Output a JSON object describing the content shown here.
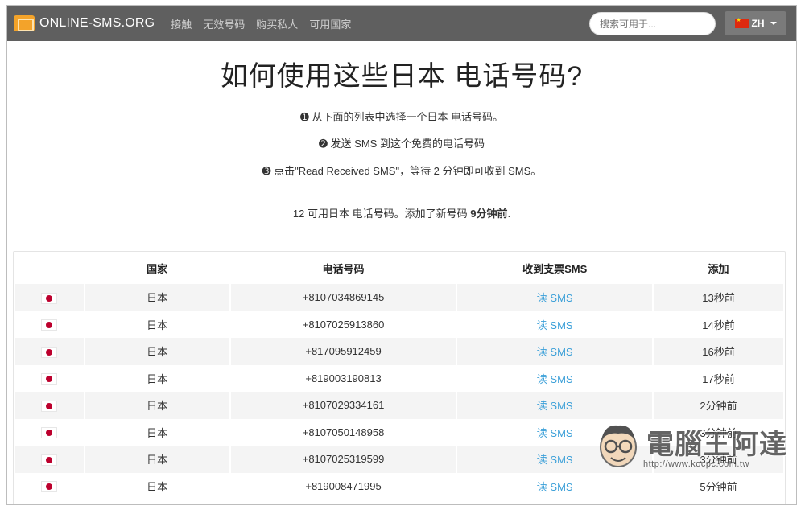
{
  "navbar": {
    "brand": "ONLINE-SMS.ORG",
    "links": [
      "接触",
      "无效号码",
      "购买私人",
      "可用国家"
    ],
    "search_placeholder": "搜索可用于...",
    "lang": "ZH"
  },
  "header": {
    "title": "如何使用这些日本 电话号码?",
    "steps": [
      "➊ 从下面的列表中选择一个日本 电话号码。",
      "➋ 发送 SMS 到这个免费的电话号码",
      "➌ 点击\"Read Received SMS\"，等待 2 分钟即可收到 SMS。"
    ],
    "summary_prefix": "12 可用日本 电话号码。添加了新号码 ",
    "summary_bold": "9分钟前",
    "summary_suffix": "."
  },
  "table": {
    "headers": [
      "国家",
      "电话号码",
      "收到支票SMS",
      "添加"
    ],
    "rows": [
      {
        "country": "日本",
        "phone": "+8107034869145",
        "link": "读 SMS",
        "added": "13秒前"
      },
      {
        "country": "日本",
        "phone": "+8107025913860",
        "link": "读 SMS",
        "added": "14秒前"
      },
      {
        "country": "日本",
        "phone": "+817095912459",
        "link": "读 SMS",
        "added": "16秒前"
      },
      {
        "country": "日本",
        "phone": "+819003190813",
        "link": "读 SMS",
        "added": "17秒前"
      },
      {
        "country": "日本",
        "phone": "+8107029334161",
        "link": "读 SMS",
        "added": "2分钟前"
      },
      {
        "country": "日本",
        "phone": "+8107050148958",
        "link": "读 SMS",
        "added": "3分钟前"
      },
      {
        "country": "日本",
        "phone": "+8107025319599",
        "link": "读 SMS",
        "added": "3分钟前"
      },
      {
        "country": "日本",
        "phone": "+819008471995",
        "link": "读 SMS",
        "added": "5分钟前"
      }
    ]
  },
  "watermark": {
    "title": "電腦王阿達",
    "url": "http://www.kocpc.com.tw"
  },
  "colors": {
    "navbar": "#5f5f5f",
    "link": "#3a9fd8",
    "row_shade": "#f4f4f4"
  }
}
